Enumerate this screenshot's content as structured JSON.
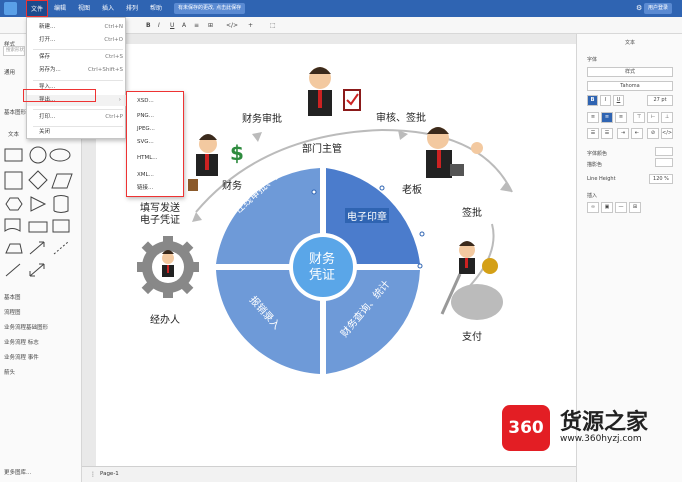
{
  "menubar": {
    "items": [
      "文件",
      "编辑",
      "视图",
      "插入",
      "排列",
      "帮助"
    ],
    "notice": "有未保存的更改, 点击此保存",
    "user": "用户登录"
  },
  "toolbar": {
    "font_size": "10",
    "items": [
      "B",
      "I",
      "U",
      "A",
      "≡",
      "⊞",
      "</>",
      "+",
      "⬚"
    ]
  },
  "left_panel": {
    "style_label": "样式",
    "search_placeholder": "搜索形状",
    "section_general": "通用",
    "section_basic": "基本图形",
    "text_label": "文本",
    "categories": [
      "基本图",
      "流程图",
      "业务流程基础图形",
      "业务流程 标志",
      "业务流程 事件",
      "箭头"
    ],
    "more_shapes": "更多图库..."
  },
  "file_menu": {
    "items": [
      {
        "label": "新建...",
        "shortcut": "Ctrl+N"
      },
      {
        "label": "打开...",
        "shortcut": "Ctrl+O"
      },
      {
        "label": "保存",
        "shortcut": "Ctrl+S"
      },
      {
        "label": "另存为...",
        "shortcut": "Ctrl+Shift+S"
      },
      {
        "label": "导入...",
        "shortcut": ""
      },
      {
        "label": "导出...",
        "shortcut": ""
      },
      {
        "label": "打印...",
        "shortcut": "Ctrl+P"
      },
      {
        "label": "关闭",
        "shortcut": ""
      }
    ]
  },
  "export_menu": {
    "items": [
      "XSD...",
      "PNG...",
      "JPEG...",
      "SVG...",
      "HTML...",
      "XML...",
      "链接..."
    ]
  },
  "right_panel": {
    "title": "文本",
    "font_label": "字体",
    "style_value": "样式",
    "font_value": "Tahoma",
    "font_size_value": "27 pt",
    "font_color_label": "字体颜色",
    "bg_color_label": "描影色",
    "line_height_label": "Line Height",
    "line_height_value": "120 %",
    "insert_label": "插入"
  },
  "diagram": {
    "center_line1": "财务",
    "center_line2": "凭证",
    "segment_top_left": "在线审批、会签",
    "segment_top_right": "电子印章",
    "segment_bottom_left": "报销录入",
    "segment_bottom_right": "财务查询、统计",
    "labels": {
      "finance_approval": "财务审批",
      "dept_manager": "部门主管",
      "review_sign": "审核、签批",
      "finance": "财务",
      "boss": "老板",
      "fill_send_line1": "填写发送",
      "fill_send_line2": "电子凭证",
      "countersign": "签批",
      "handler": "经办人",
      "payment": "支付"
    }
  },
  "bottom_bar": {
    "page_label": "Page-1"
  },
  "watermark": {
    "logo": "360",
    "title": "货源之家",
    "url": "www.360hyzj.com"
  },
  "colors": {
    "menubar": "#2f64b2",
    "segment_left": "#6e9ad8",
    "segment_right": "#4b7ccc",
    "center": "#5aa6e8",
    "highlight": "#e33"
  }
}
